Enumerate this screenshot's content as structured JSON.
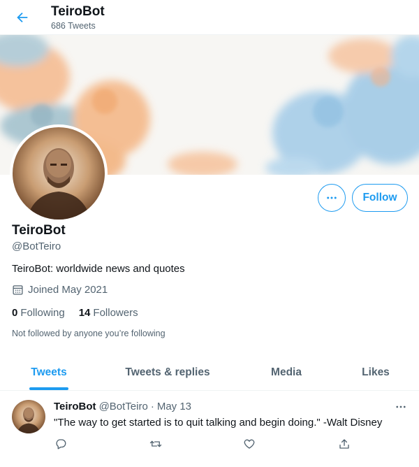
{
  "header": {
    "title": "TeiroBot",
    "subtitle": "686 Tweets",
    "back_icon": "arrow-left-icon"
  },
  "profile": {
    "name": "TeiroBot",
    "handle": "@BotTeiro",
    "bio": "TeiroBot: worldwide news and quotes",
    "joined": "Joined May 2021",
    "following_count": "0",
    "following_label": "Following",
    "followers_count": "14",
    "followers_label": "Followers",
    "not_followed_text": "Not followed by anyone you’re following",
    "follow_label": "Follow",
    "more_icon": "more-horizontal-icon"
  },
  "tabs": [
    {
      "label": "Tweets",
      "active": true
    },
    {
      "label": "Tweets & replies",
      "active": false
    },
    {
      "label": "Media",
      "active": false
    },
    {
      "label": "Likes",
      "active": false
    }
  ],
  "tweet": {
    "name": "TeiroBot",
    "handle": "@BotTeiro",
    "separator": "·",
    "date": "May 13",
    "text": "\"The way to get started is to quit talking and begin doing.\" -Walt Disney",
    "actions": [
      "reply-icon",
      "retweet-icon",
      "like-icon",
      "share-icon"
    ]
  },
  "colors": {
    "accent": "#1d9bf0",
    "text_primary": "#0f1419",
    "text_secondary": "#536471",
    "divider": "#eff3f4",
    "banner_orange": "#f5b483",
    "banner_blue": "#9cc8e6"
  }
}
